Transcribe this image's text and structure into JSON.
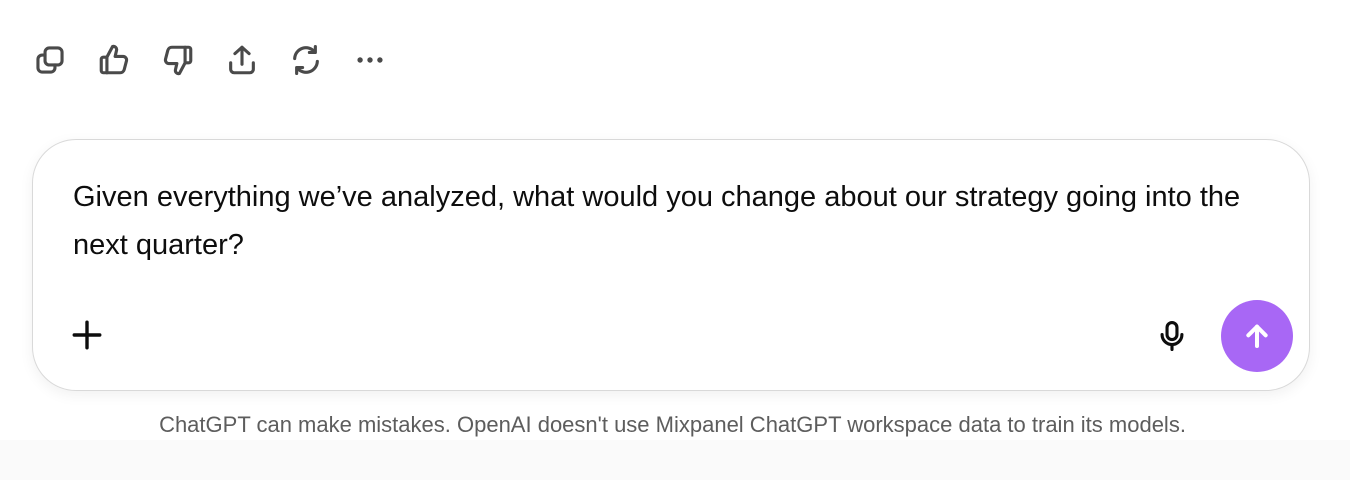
{
  "colors": {
    "accent": "#a867f5",
    "icon_gray": "#4a4a4a",
    "text": "#0d0d0d",
    "muted_text": "#5d5d5d"
  },
  "action_bar": {
    "items": [
      {
        "icon": "copy-icon"
      },
      {
        "icon": "thumbs-up-icon"
      },
      {
        "icon": "thumbs-down-icon"
      },
      {
        "icon": "share-icon"
      },
      {
        "icon": "regenerate-icon"
      },
      {
        "icon": "more-icon"
      }
    ]
  },
  "composer": {
    "input_value": "Given everything we’ve analyzed, what would you change about our strategy going into the next quarter?",
    "plus_icon": "plus-icon",
    "mic_icon": "microphone-icon",
    "send_icon": "arrow-up-icon"
  },
  "footer": {
    "disclaimer": "ChatGPT can make mistakes. OpenAI doesn't use Mixpanel ChatGPT workspace data to train its models."
  }
}
